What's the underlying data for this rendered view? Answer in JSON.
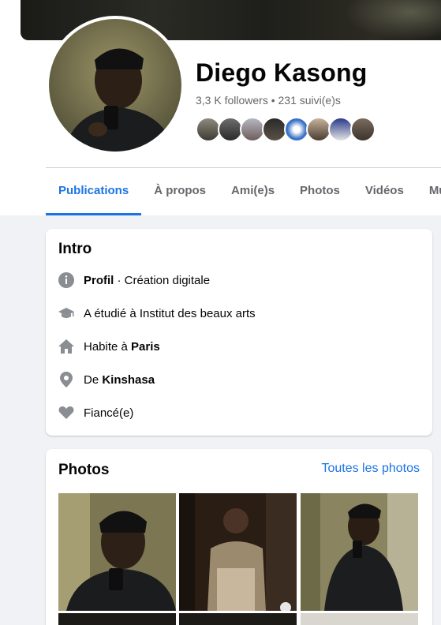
{
  "profile": {
    "name": "Diego Kasong",
    "stats": "3,3 K followers • 231 suivi(e)s",
    "friends": [
      "friend-1",
      "friend-2",
      "friend-3",
      "friend-4",
      "friend-5",
      "friend-6",
      "friend-7",
      "friend-8"
    ]
  },
  "tabs": [
    {
      "label": "Publications",
      "active": true
    },
    {
      "label": "À propos"
    },
    {
      "label": "Ami(e)s"
    },
    {
      "label": "Photos"
    },
    {
      "label": "Vidéos"
    },
    {
      "label": "Musi"
    }
  ],
  "intro": {
    "title": "Intro",
    "profile_bold": "Profil",
    "profile_rest": " · Création digitale",
    "studied": "A étudié à Institut des beaux arts",
    "lives_prefix": "Habite à ",
    "lives_city": "Paris",
    "from_prefix": "De ",
    "from_city": "Kinshasa",
    "relationship": "Fiancé(e)",
    "icons": [
      "info-icon",
      "graduation-cap-icon",
      "home-icon",
      "location-pin-icon",
      "heart-icon"
    ]
  },
  "photos": {
    "title": "Photos",
    "see_all": "Toutes les photos"
  },
  "colors": {
    "accent": "#1b74e4",
    "muted": "#65676b",
    "icon": "#8a8d91"
  }
}
